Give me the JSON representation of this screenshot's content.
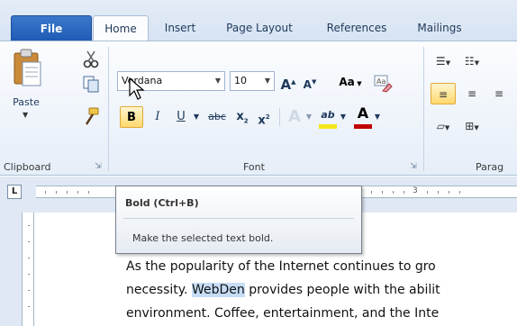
{
  "tabs": {
    "file": "File",
    "home": "Home",
    "insert": "Insert",
    "page_layout": "Page Layout",
    "references": "References",
    "mailings": "Mailings"
  },
  "clipboard": {
    "paste_label": "Paste",
    "group_label": "Clipboard",
    "icons": [
      "paste-icon",
      "cut-icon",
      "copy-icon",
      "format-painter-icon"
    ]
  },
  "font": {
    "font_name": "Verdana",
    "font_size": "10",
    "grow_label": "A",
    "shrink_label": "A",
    "case_label": "Aa",
    "bold_label": "B",
    "italic_label": "I",
    "underline_label": "U",
    "strike_label": "abc",
    "subscript_label": "x",
    "superscript_label": "x",
    "text_effects_label": "A",
    "highlight_label": "ab",
    "font_color_label": "A",
    "group_label": "Font",
    "highlight_color": "#f5e51a",
    "font_color": "#c00000"
  },
  "paragraph": {
    "group_label": "Parag"
  },
  "ruler": {
    "corner_label": "L",
    "number_3": "3"
  },
  "tooltip": {
    "title": "Bold (Ctrl+B)",
    "description": "Make the selected text bold."
  },
  "document": {
    "line1": "As the popularity of the Internet continues to gro",
    "line2_before": "necessity. ",
    "line2_highlight": "WebDen",
    "line2_after": " provides people with the abilit",
    "line3": "environment. Coffee, entertainment, and the Inte"
  },
  "colors": {
    "file_tab": "#2a66c0",
    "bold_button_active": "#ffd86d",
    "selection": "#c6ddf6"
  }
}
